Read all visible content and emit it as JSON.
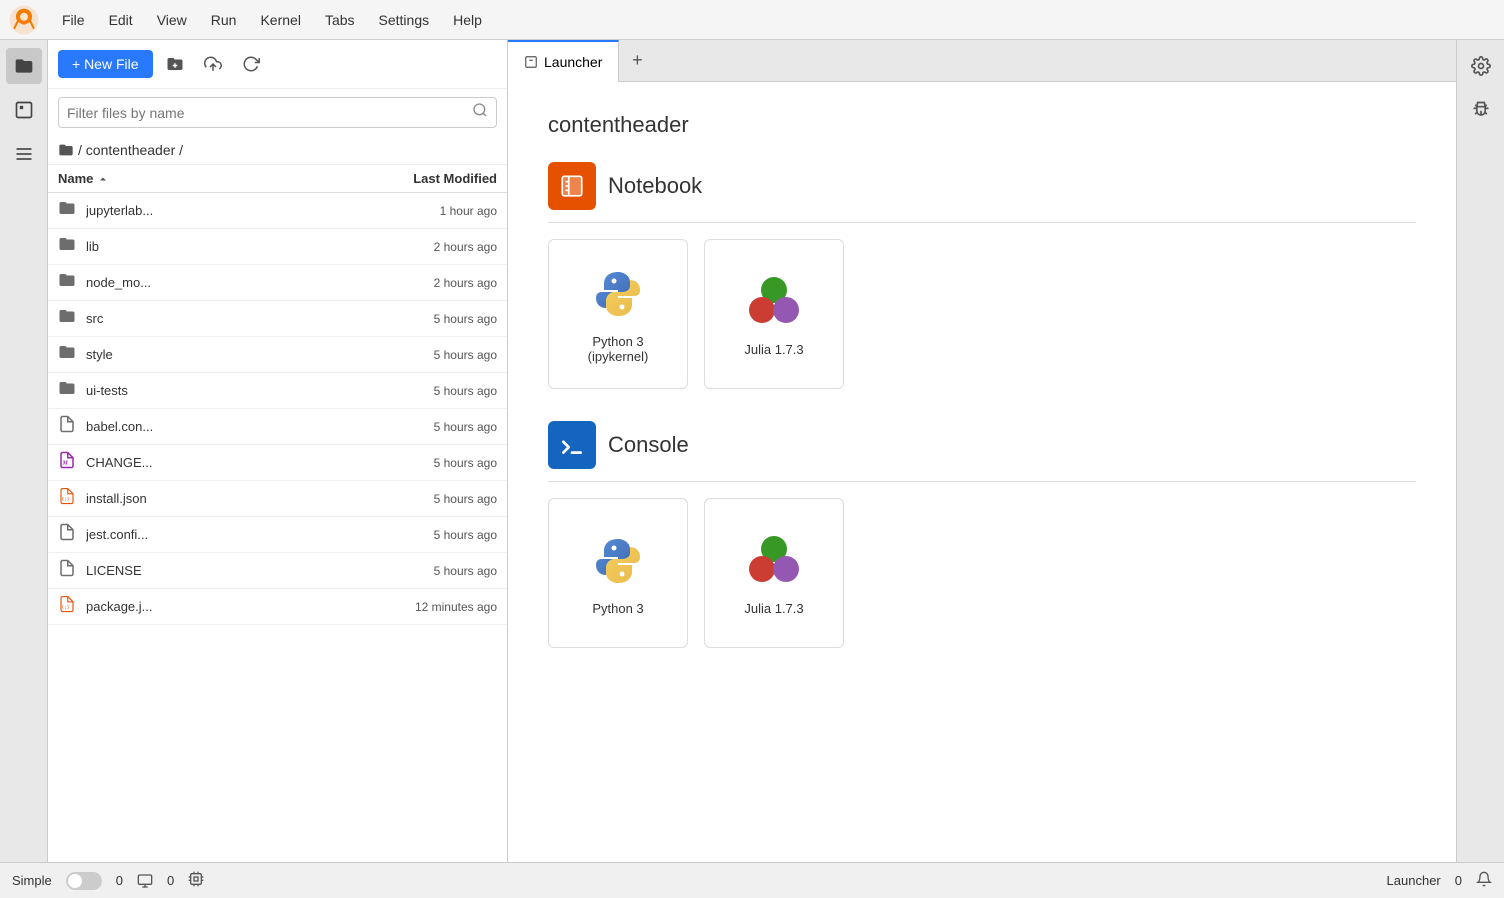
{
  "menu": {
    "items": [
      "File",
      "Edit",
      "View",
      "Run",
      "Kernel",
      "Tabs",
      "Settings",
      "Help"
    ]
  },
  "toolbar": {
    "new_file_label": "+ New File",
    "new_folder_tooltip": "New Folder",
    "upload_tooltip": "Upload",
    "refresh_tooltip": "Refresh"
  },
  "search": {
    "placeholder": "Filter files by name"
  },
  "breadcrumb": "/ contentheader /",
  "file_list": {
    "col_name": "Name",
    "col_modified": "Last Modified",
    "files": [
      {
        "name": "jupyterlab...",
        "type": "folder",
        "modified": "1 hour ago"
      },
      {
        "name": "lib",
        "type": "folder",
        "modified": "2 hours ago"
      },
      {
        "name": "node_mo...",
        "type": "folder",
        "modified": "2 hours ago"
      },
      {
        "name": "src",
        "type": "folder",
        "modified": "5 hours ago"
      },
      {
        "name": "style",
        "type": "folder",
        "modified": "5 hours ago"
      },
      {
        "name": "ui-tests",
        "type": "folder",
        "modified": "5 hours ago"
      },
      {
        "name": "babel.con...",
        "type": "file",
        "modified": "5 hours ago"
      },
      {
        "name": "CHANGE...",
        "type": "markdown",
        "modified": "5 hours ago"
      },
      {
        "name": "install.json",
        "type": "json",
        "modified": "5 hours ago"
      },
      {
        "name": "jest.confi...",
        "type": "file",
        "modified": "5 hours ago"
      },
      {
        "name": "LICENSE",
        "type": "file",
        "modified": "5 hours ago"
      },
      {
        "name": "package.j...",
        "type": "json",
        "modified": "12 minutes ago"
      }
    ]
  },
  "tab": {
    "label": "Launcher",
    "add_label": "+"
  },
  "launcher": {
    "title": "contentheader",
    "notebook_section": "Notebook",
    "console_section": "Console",
    "kernels": [
      {
        "name": "Python 3\n(ipykernel)",
        "type": "python"
      },
      {
        "name": "Julia 1.7.3",
        "type": "julia"
      }
    ],
    "console_kernels": [
      {
        "name": "Python 3",
        "type": "python"
      },
      {
        "name": "Julia 1.7.3",
        "type": "julia"
      }
    ]
  },
  "status_bar": {
    "simple_label": "Simple",
    "count1": "0",
    "count2": "0",
    "right_label": "Launcher",
    "right_count": "0"
  },
  "icons": {
    "folder": "📁",
    "file": "📄",
    "notebook": "🔖",
    "console": ">_",
    "gear": "⚙",
    "bug": "🐛",
    "search": "🔍",
    "bell": "🔔",
    "dollar": "$",
    "cpu": "▣"
  }
}
